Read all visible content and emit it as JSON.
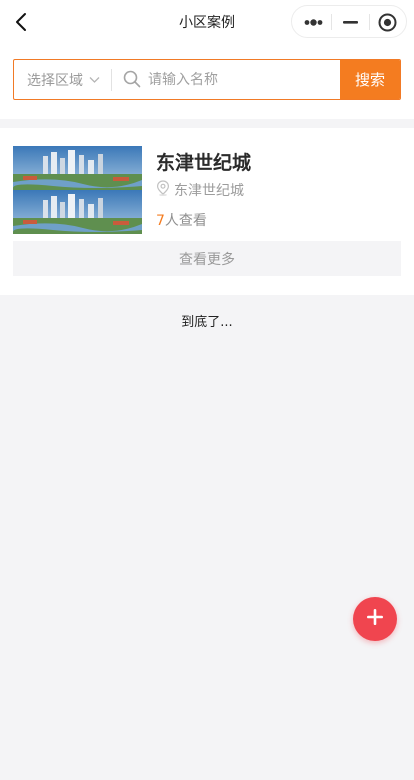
{
  "navbar": {
    "title": "小区案例",
    "back_icon": "chevron-left-icon",
    "capsule": {
      "more_icon": "more-dots-icon",
      "minimize_icon": "minus-icon",
      "close_icon": "target-circle-icon"
    }
  },
  "search": {
    "region_label": "选择区域",
    "region_icon": "chevron-down-icon",
    "placeholder": "请输入名称",
    "value": "",
    "button_label": "搜索",
    "accent_color": "#f47c20"
  },
  "list": {
    "items": [
      {
        "title": "东津世纪城",
        "location": "东津世纪城",
        "views_count": "7",
        "views_suffix": "人查看",
        "more_label": "查看更多"
      }
    ]
  },
  "footer": {
    "end_text": "到底了..."
  },
  "fab": {
    "icon": "plus-icon",
    "color": "#f0454f"
  }
}
